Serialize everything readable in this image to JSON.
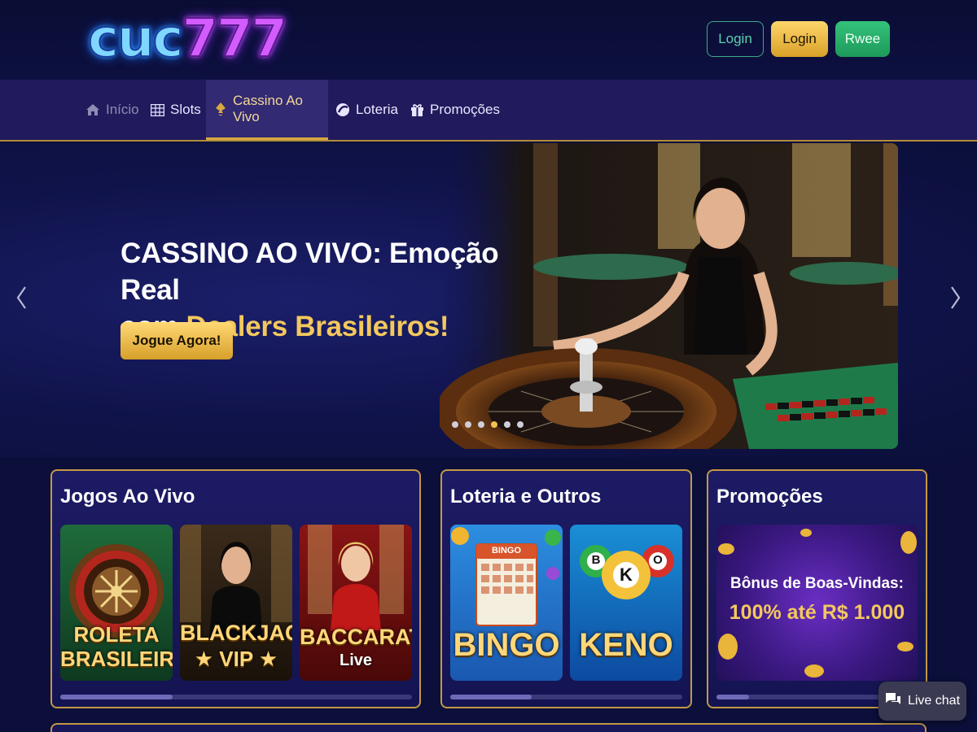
{
  "header": {
    "logo_text_a": "cuc",
    "logo_text_b": "777",
    "buttons": {
      "login_outline": "Login",
      "login_gold": "Login",
      "register": "Rwee"
    }
  },
  "nav": {
    "items": [
      {
        "label": "Início",
        "icon": "home-icon"
      },
      {
        "label": "Slots",
        "icon": "slot-grid-icon"
      },
      {
        "label": "Cassino Ao Vivo",
        "icon": "spade-icon",
        "active": true
      },
      {
        "label": "Loteria",
        "icon": "lottery-ball-icon"
      },
      {
        "label": "Promoções",
        "icon": "gift-icon"
      }
    ]
  },
  "hero": {
    "title_line1": "CASSINO AO VIVO: Emoção Real",
    "title_line2_plain": "com ",
    "title_line2_gold": "Dealers Brasileiros!",
    "cta": "Jogue Agora!",
    "slides_total": 6,
    "slide_active": 4
  },
  "sections": {
    "live": {
      "title": "Jogos Ao Vivo",
      "tiles": [
        {
          "line1": "ROLETA",
          "line2": "BRASILEIRA"
        },
        {
          "line1": "BLACKJACK",
          "line2": "★ VIP ★"
        },
        {
          "line1": "BACCARAT",
          "line2": "Live"
        }
      ],
      "progress": 0.32
    },
    "lottery": {
      "title": "Loteria e Outros",
      "tiles": [
        {
          "label": "BINGO",
          "card_header": "BINGO"
        },
        {
          "label": "KENO",
          "ball_letters": [
            "B",
            "K",
            "O"
          ]
        }
      ],
      "progress": 0.35
    },
    "promos": {
      "title": "Promoções",
      "banner_line1": "Bônus de Boas-Vindas:",
      "banner_line2": "100% até R$ 1.000",
      "progress": 0.2
    }
  },
  "chat": {
    "label": "Live chat",
    "icon": "chat-bubble-icon"
  },
  "colors": {
    "background": "#0b0f3a",
    "nav": "#211a5c",
    "gold": "#f3c85d",
    "card_border": "#c39945",
    "register_green": "#27a865"
  }
}
